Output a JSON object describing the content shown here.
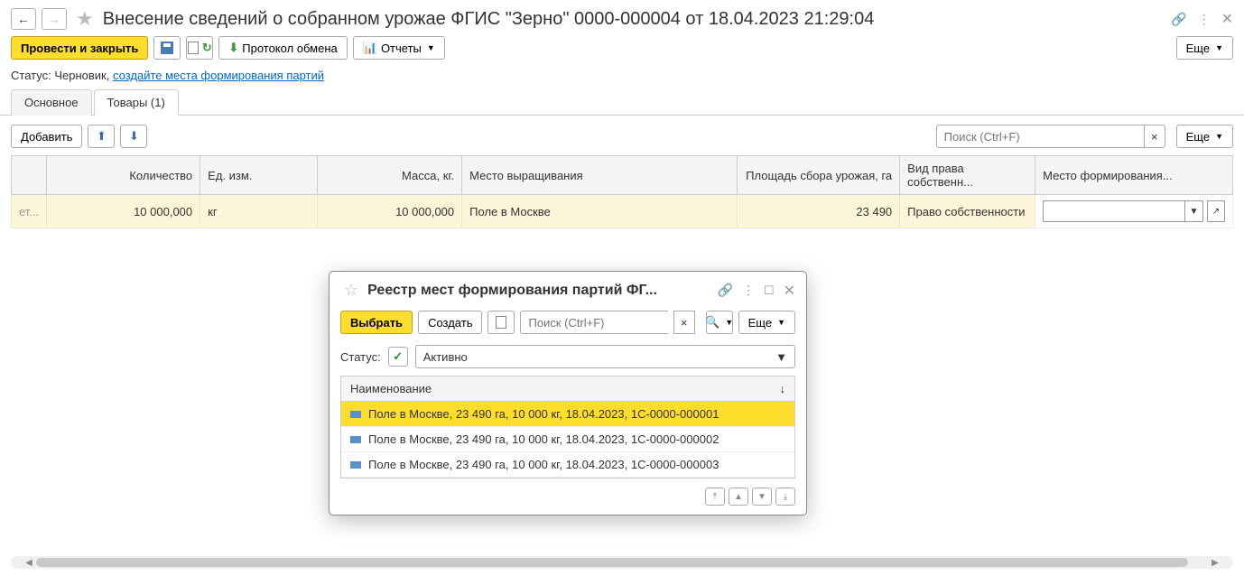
{
  "header": {
    "title": "Внесение сведений о собранном урожае ФГИС \"Зерно\" 0000-000004 от 18.04.2023 21:29:04"
  },
  "toolbar": {
    "post_close": "Провести и закрыть",
    "protocol": "Протокол обмена",
    "reports": "Отчеты",
    "more": "Еще"
  },
  "status": {
    "label": "Статус:",
    "value": "Черновик,",
    "link": "создайте места формирования партий"
  },
  "tabs": {
    "main": "Основное",
    "goods": "Товары (1)"
  },
  "content_toolbar": {
    "add": "Добавить",
    "search_placeholder": "Поиск (Ctrl+F)",
    "more": "Еще"
  },
  "table": {
    "headers": {
      "c0": "",
      "c1": "Количество",
      "c2": "Ед. изм.",
      "c3": "Масса, кг.",
      "c4": "Место выращивания",
      "c5": "Площадь сбора урожая, га",
      "c6": "Вид права собственн...",
      "c7": "Место формирования..."
    },
    "row": {
      "c0": "ет...",
      "c1": "10 000,000",
      "c2": "кг",
      "c3": "10 000,000",
      "c4": "Поле в Москве",
      "c5": "23 490",
      "c6": "Право собственности"
    }
  },
  "dialog": {
    "title": "Реестр мест формирования партий ФГ...",
    "select": "Выбрать",
    "create": "Создать",
    "search_placeholder": "Поиск (Ctrl+F)",
    "more": "Еще",
    "status_label": "Статус:",
    "status_value": "Активно",
    "list_header": "Наименование",
    "items": [
      "Поле в Москве, 23 490 га, 10 000 кг, 18.04.2023, 1С-0000-000001",
      "Поле в Москве, 23 490 га, 10 000 кг, 18.04.2023, 1С-0000-000002",
      "Поле в Москве, 23 490 га, 10 000 кг, 18.04.2023, 1С-0000-000003"
    ]
  }
}
